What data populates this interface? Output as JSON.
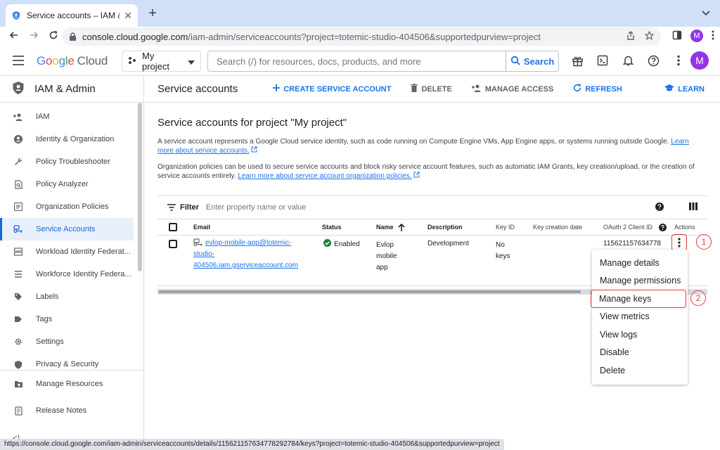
{
  "browser": {
    "tab_title": "Service accounts – IAM & Admin",
    "tab_close": "✕",
    "new_tab": "+",
    "url_host": "console.cloud.google.com",
    "url_path": "/iam-admin/serviceaccounts?project=totemic-studio-404506&supportedpurview=project",
    "profile_initial": "M",
    "status_url": "https://console.cloud.google.com/iam-admin/serviceaccounts/details/115621157634778292784/keys?project=totemic-studio-404506&supportedpurview=project"
  },
  "header": {
    "logo_g": "G",
    "logo_o1": "o",
    "logo_o2": "o",
    "logo_g2": "g",
    "logo_l": "l",
    "logo_e": "e",
    "logo_cloud": "Cloud",
    "project": "My project",
    "search_placeholder": "Search (/) for resources, docs, products, and more",
    "search_button": "Search",
    "avatar_initial": "M"
  },
  "sidebar": {
    "title": "IAM & Admin",
    "items": [
      {
        "label": "IAM",
        "icon": "person-add-icon"
      },
      {
        "label": "Identity & Organization",
        "icon": "account-circle-icon"
      },
      {
        "label": "Policy Troubleshooter",
        "icon": "wrench-icon"
      },
      {
        "label": "Policy Analyzer",
        "icon": "document-search-icon"
      },
      {
        "label": "Organization Policies",
        "icon": "list-box-icon"
      },
      {
        "label": "Service Accounts",
        "icon": "service-account-icon"
      },
      {
        "label": "Workload Identity Federat...",
        "icon": "server-icon"
      },
      {
        "label": "Workforce Identity Federa...",
        "icon": "list-icon"
      },
      {
        "label": "Labels",
        "icon": "label-icon"
      },
      {
        "label": "Tags",
        "icon": "tag-icon"
      },
      {
        "label": "Settings",
        "icon": "gear-icon"
      },
      {
        "label": "Privacy & Security",
        "icon": "shield-icon"
      }
    ],
    "bottom": [
      {
        "label": "Manage Resources",
        "icon": "folder-gear-icon"
      },
      {
        "label": "Release Notes",
        "icon": "notes-icon"
      }
    ],
    "collapse": "<|"
  },
  "toolbar": {
    "title": "Service accounts",
    "create": "CREATE SERVICE ACCOUNT",
    "delete": "DELETE",
    "manage_access": "MANAGE ACCESS",
    "refresh": "REFRESH",
    "learn": "LEARN"
  },
  "content": {
    "heading": "Service accounts for project \"My project\"",
    "desc1": "A service account represents a Google Cloud service identity, such as code running on Compute Engine VMs, App Engine apps, or systems running outside Google.",
    "desc1_link": "Learn more about service accounts.",
    "desc2": "Organization policies can be used to secure service accounts and block risky service account features, such as automatic IAM Grants, key creation/upload, or the creation of service accounts entirely.",
    "desc2_link": "Learn more about service account organization policies."
  },
  "table": {
    "filter_label": "Filter",
    "filter_placeholder": "Enter property name or value",
    "columns": {
      "email": "Email",
      "status": "Status",
      "name": "Name",
      "description": "Description",
      "key_id": "Key ID",
      "key_creation": "Key creation date",
      "oauth": "OAuth 2 Client ID",
      "actions": "Actions"
    },
    "row": {
      "email_1": "evlop-mobile-app@totemic-",
      "email_2": "studio-",
      "email_3": "404506.iam.gserviceaccount.com",
      "status": "Enabled",
      "name_1": "Evlop",
      "name_2": "mobile",
      "name_3": "app",
      "description": "Development",
      "key_1": "No",
      "key_2": "keys",
      "oauth": "115621157634778"
    }
  },
  "menu": {
    "items": [
      "Manage details",
      "Manage permissions",
      "Manage keys",
      "View metrics",
      "View logs",
      "Disable",
      "Delete"
    ]
  },
  "annotations": {
    "step1": "1",
    "step2": "2"
  },
  "colors": {
    "accent": "#1a73e8",
    "annotation": "#e53935",
    "enabled": "#188038"
  }
}
